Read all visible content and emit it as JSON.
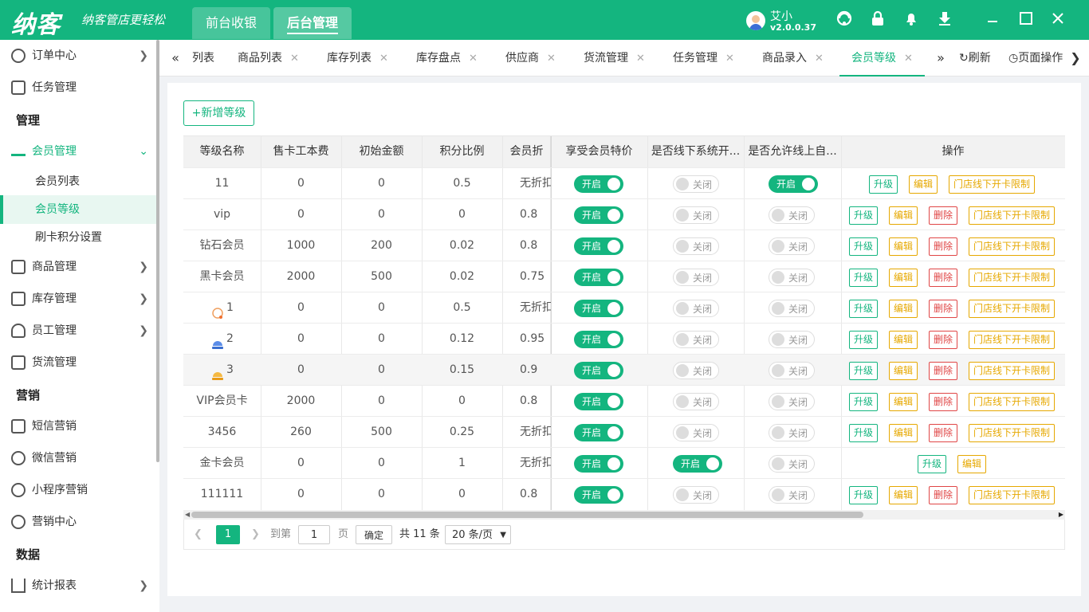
{
  "app": {
    "logo": "纳客",
    "slogan": "纳客管店更轻松",
    "top_tabs": [
      "前台收银",
      "后台管理"
    ],
    "user_name": "艾小",
    "version": "v2.0.0.37"
  },
  "sidebar": {
    "items": [
      {
        "label": "订单中心"
      },
      {
        "label": "任务管理"
      }
    ],
    "group_manage": "管理",
    "member_mgmt": "会员管理",
    "member_subs": [
      "会员列表",
      "会员等级",
      "刷卡积分设置"
    ],
    "items2": [
      "商品管理",
      "库存管理",
      "员工管理",
      "货流管理"
    ],
    "group_marketing": "营销",
    "marketing": [
      "短信营销",
      "微信营销",
      "小程序营销",
      "营销中心"
    ],
    "group_data": "数据",
    "data_items": [
      "统计报表"
    ]
  },
  "tabbar": {
    "tabs": [
      "列表",
      "商品列表",
      "库存列表",
      "库存盘点",
      "供应商",
      "货流管理",
      "任务管理",
      "商品录入",
      "会员等级"
    ],
    "refresh": "刷新",
    "page_ops": "页面操作"
  },
  "main": {
    "add_button": "+新增等级",
    "columns": [
      "等级名称",
      "售卡工本费",
      "初始金额",
      "积分比例",
      "会员折",
      "享受会员特价",
      "是否线下系统开...",
      "是否允许线上自...",
      "操作"
    ],
    "switch_on": "开启",
    "switch_off": "关闭",
    "op_labels": {
      "upgrade": "升级",
      "edit": "编辑",
      "delete": "删除",
      "limit": "门店线下开卡限制"
    },
    "rows": [
      {
        "name": "11",
        "fee": "0",
        "init": "0",
        "ratio": "0.5",
        "disc": "无折扣",
        "special": true,
        "offline": false,
        "online": true,
        "ops": "ue_l"
      },
      {
        "name": "vip",
        "fee": "0",
        "init": "0",
        "ratio": "0",
        "disc": "0.8",
        "special": true,
        "offline": false,
        "online": false,
        "ops": "uedl"
      },
      {
        "name": "钻石会员",
        "fee": "1000",
        "init": "200",
        "ratio": "0.02",
        "disc": "0.8",
        "special": true,
        "offline": false,
        "online": false,
        "ops": "uedl"
      },
      {
        "name": "黑卡会员",
        "fee": "2000",
        "init": "500",
        "ratio": "0.02",
        "disc": "0.75",
        "special": true,
        "offline": false,
        "online": false,
        "ops": "uedl"
      },
      {
        "name": "1",
        "icon": "silver-level-icon",
        "fee": "0",
        "init": "0",
        "ratio": "0.5",
        "disc": "无折扣",
        "special": true,
        "offline": false,
        "online": false,
        "ops": "uedl"
      },
      {
        "name": "2",
        "icon": "blue-crown-level-icon",
        "fee": "0",
        "init": "0",
        "ratio": "0.12",
        "disc": "0.95",
        "special": true,
        "offline": false,
        "online": false,
        "ops": "uedl"
      },
      {
        "name": "3",
        "icon": "gold-crown-level-icon",
        "fee": "0",
        "init": "0",
        "ratio": "0.15",
        "disc": "0.9",
        "special": true,
        "offline": false,
        "online": false,
        "ops": "uedl"
      },
      {
        "name": "VIP会员卡",
        "fee": "2000",
        "init": "0",
        "ratio": "0",
        "disc": "0.8",
        "special": true,
        "offline": false,
        "online": false,
        "ops": "uedl"
      },
      {
        "name": "3456",
        "fee": "260",
        "init": "500",
        "ratio": "0.25",
        "disc": "无折扣",
        "special": true,
        "offline": false,
        "online": false,
        "ops": "uedl"
      },
      {
        "name": "金卡会员",
        "fee": "0",
        "init": "0",
        "ratio": "1",
        "disc": "无折扣",
        "special": true,
        "offline": true,
        "online": false,
        "ops": "ue"
      },
      {
        "name": "111111",
        "fee": "0",
        "init": "0",
        "ratio": "0",
        "disc": "0.8",
        "special": true,
        "offline": false,
        "online": false,
        "ops": "uedl"
      }
    ]
  },
  "pager": {
    "current": "1",
    "goto_label": "到第",
    "goto_value": "1",
    "page_label": "页",
    "confirm": "确定",
    "total": "共 11 条",
    "page_size": "20 条/页"
  },
  "colors": {
    "brand": "#14b57f",
    "edit": "#e6a800",
    "delete": "#e04646"
  }
}
